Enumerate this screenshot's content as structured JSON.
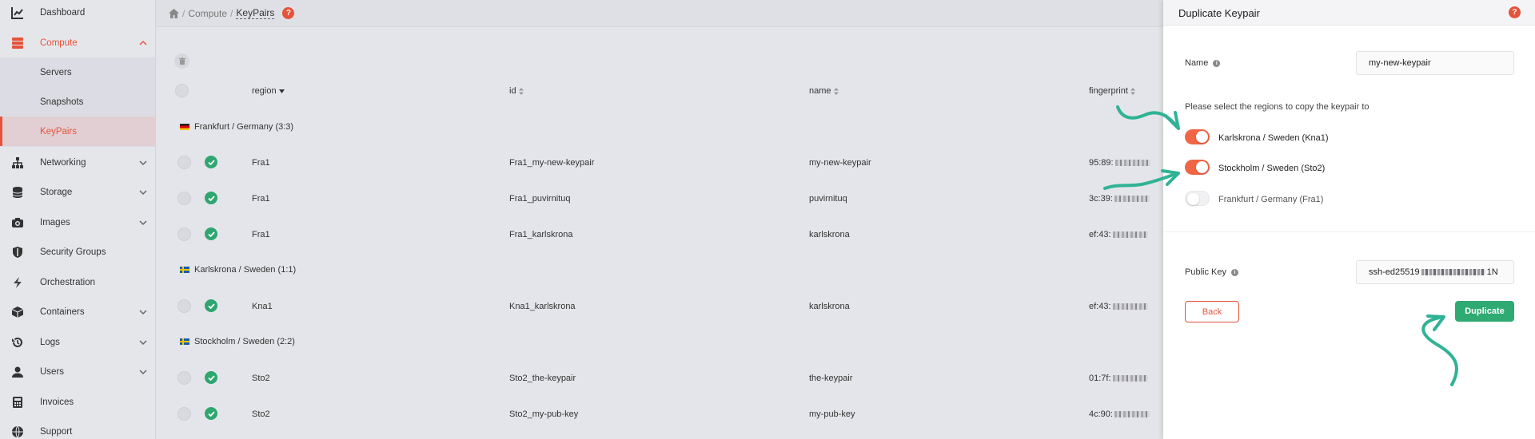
{
  "sidebar": {
    "items": [
      {
        "label": "Dashboard",
        "icon": "chart-icon"
      },
      {
        "label": "Compute",
        "icon": "server-stack-icon",
        "expanded": true
      },
      {
        "label": "Networking",
        "icon": "network-icon"
      },
      {
        "label": "Storage",
        "icon": "database-icon"
      },
      {
        "label": "Images",
        "icon": "camera-icon"
      },
      {
        "label": "Security Groups",
        "icon": "shield-icon"
      },
      {
        "label": "Orchestration",
        "icon": "orchestration-icon"
      },
      {
        "label": "Containers",
        "icon": "box-icon"
      },
      {
        "label": "Logs",
        "icon": "history-icon"
      },
      {
        "label": "Users",
        "icon": "user-icon"
      },
      {
        "label": "Invoices",
        "icon": "calculator-icon"
      },
      {
        "label": "Support",
        "icon": "globe-icon"
      }
    ],
    "compute_sub": [
      {
        "label": "Servers"
      },
      {
        "label": "Snapshots"
      },
      {
        "label": "KeyPairs",
        "active": true
      }
    ]
  },
  "breadcrumb": {
    "separator": "/",
    "section": "Compute",
    "current": "KeyPairs"
  },
  "table": {
    "headers": {
      "region": "region",
      "id": "id",
      "name": "name",
      "fingerprint": "fingerprint"
    },
    "groups": [
      {
        "label": "Frankfurt / Germany (3:3)",
        "flag": "de",
        "rows": [
          {
            "region": "Fra1",
            "id": "Fra1_my-new-keypair",
            "name": "my-new-keypair",
            "fp": "95:89:"
          },
          {
            "region": "Fra1",
            "id": "Fra1_puvirnituq",
            "name": "puvirnituq",
            "fp": "3c:39:"
          },
          {
            "region": "Fra1",
            "id": "Fra1_karlskrona",
            "name": "karlskrona",
            "fp": "ef:43:"
          }
        ]
      },
      {
        "label": "Karlskrona / Sweden (1:1)",
        "flag": "se",
        "rows": [
          {
            "region": "Kna1",
            "id": "Kna1_karlskrona",
            "name": "karlskrona",
            "fp": "ef:43:"
          }
        ]
      },
      {
        "label": "Stockholm / Sweden (2:2)",
        "flag": "se",
        "rows": [
          {
            "region": "Sto2",
            "id": "Sto2_the-keypair",
            "name": "the-keypair",
            "fp": "01:7f:"
          },
          {
            "region": "Sto2",
            "id": "Sto2_my-pub-key",
            "name": "my-pub-key",
            "fp": "4c:90:"
          }
        ]
      }
    ]
  },
  "panel": {
    "title": "Duplicate Keypair",
    "help": "?",
    "name_label": "Name",
    "name_value": "my-new-keypair",
    "hint": "Please select the regions to copy the keypair to",
    "regions": [
      {
        "label": "Karlskrona / Sweden (Kna1)",
        "on": true
      },
      {
        "label": "Stockholm / Sweden (Sto2)",
        "on": true
      },
      {
        "label": "Frankfurt / Germany (Fra1)",
        "on": false
      }
    ],
    "public_key_label": "Public Key",
    "public_key_prefix": "ssh-ed25519",
    "public_key_suffix": "1N",
    "back_label": "Back",
    "duplicate_label": "Duplicate"
  },
  "colors": {
    "accent": "#e5533a",
    "success": "#2eaa72",
    "annotation": "#2fb394"
  }
}
